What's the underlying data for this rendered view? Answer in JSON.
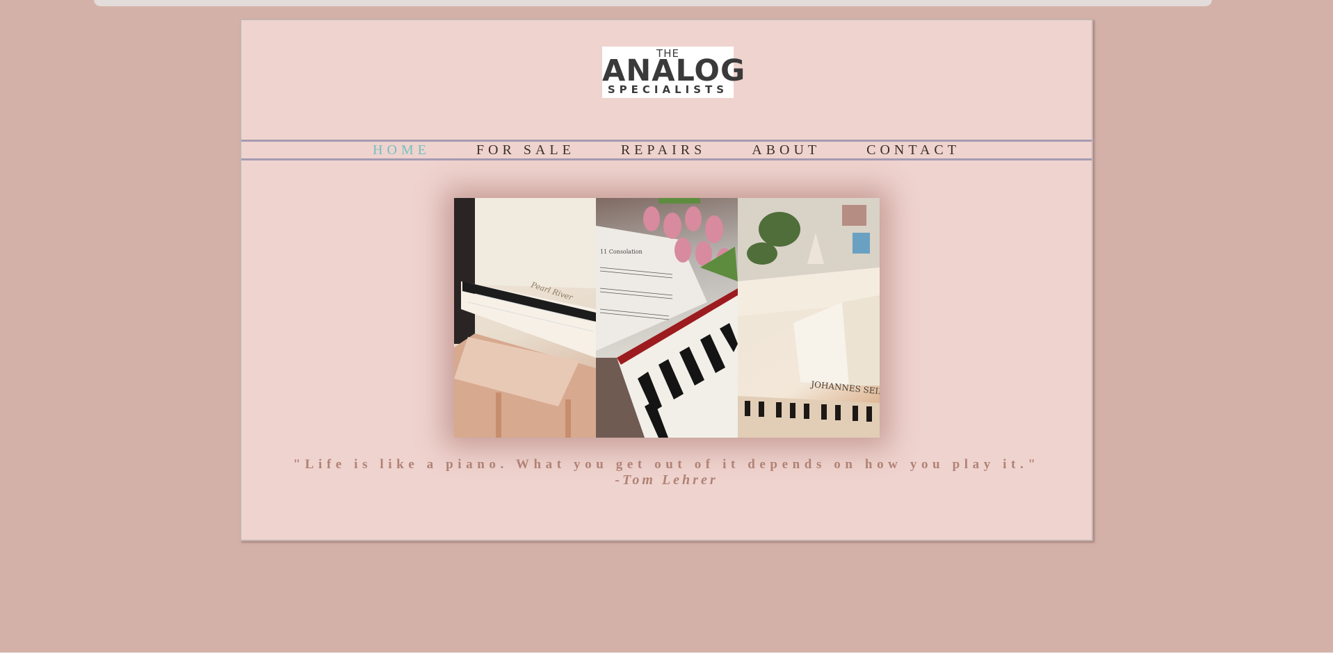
{
  "logo": {
    "the": "THE",
    "main": "ANALOG",
    "sub": "SPECIALISTS"
  },
  "nav": {
    "items": [
      {
        "label": "HOME",
        "active": true
      },
      {
        "label": "FOR SALE",
        "active": false
      },
      {
        "label": "REPAIRS",
        "active": false
      },
      {
        "label": "ABOUT",
        "active": false
      },
      {
        "label": "CONTACT",
        "active": false
      }
    ]
  },
  "gallery": {
    "panels": [
      {
        "piano_label": "Pearl River"
      },
      {
        "sheet_label": "11 Consolation"
      },
      {
        "piano_label": "JOHANNES SEILER"
      }
    ]
  },
  "quote": {
    "text": "\"Life is like a piano. What you get out of it depends on how you play it.\"",
    "author": "-Tom Lehrer"
  },
  "colors": {
    "background": "#d4b1a8",
    "page": "#efd3ce",
    "nav_border": "#a59bb2",
    "nav_active": "#76bfc0",
    "quote": "#b08275"
  }
}
